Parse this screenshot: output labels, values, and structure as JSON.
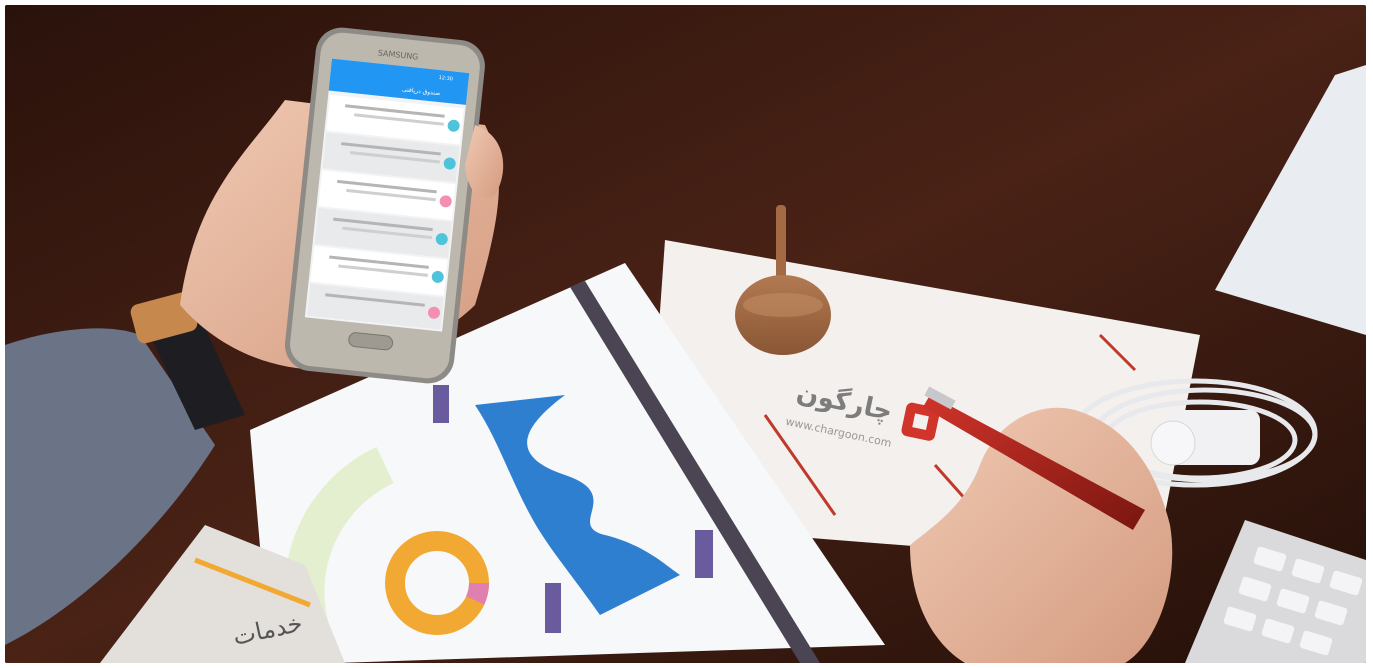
{
  "photo": {
    "description_hidden": "",
    "phone": {
      "brand": "SAMSUNG",
      "app_title": "صندوق دریافتی",
      "status_time": "12:30"
    },
    "letterhead": {
      "logo_text": "چارگون",
      "website": "www.chargoon.com"
    },
    "brochure": {
      "text": "خدمات"
    }
  }
}
